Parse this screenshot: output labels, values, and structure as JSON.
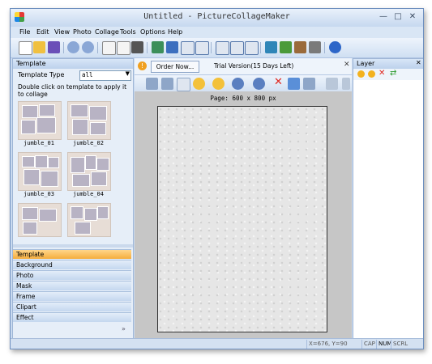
{
  "window": {
    "title": "Untitled - PictureCollageMaker"
  },
  "menu": [
    "File",
    "Edit",
    "View",
    "Photo",
    "Collage",
    "Tools",
    "Options",
    "Help"
  ],
  "left_panel": {
    "header": "Template",
    "type_label": "Template Type",
    "type_value": "all",
    "hint": "Double click on template to apply it to collage",
    "templates": [
      "jumble_01",
      "jumble_02",
      "jumble_03",
      "jumble_04"
    ],
    "nav_tabs": [
      "Template",
      "Background",
      "Photo",
      "Mask",
      "Frame",
      "Clipart",
      "Effect"
    ],
    "active_tab": "Template"
  },
  "infobar": {
    "order_button": "Order Now...",
    "trial_text": "Trial Version(15 Days Left)"
  },
  "canvas": {
    "page_label": "Page: 600 x 800 px"
  },
  "layer_panel": {
    "header": "Layer"
  },
  "status": {
    "coords": "X=676, Y=90",
    "cap": "CAP",
    "num": "NUM",
    "scrl": "SCRL"
  }
}
